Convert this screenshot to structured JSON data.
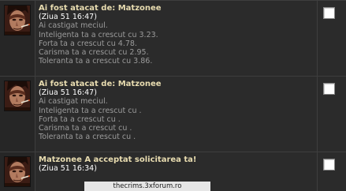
{
  "messages": [
    {
      "title": "Ai fost atacat de: Matzonee",
      "time": "(Ziua 51 16:47)",
      "lines": [
        "Ai castigat meciul.",
        "Inteligenta ta a crescut cu 3.23.",
        "Forta ta a crescut cu 4.78.",
        "Carisma ta a crescut cu 2.95.",
        "Toleranta ta a crescut cu 3.86."
      ],
      "avatar_icon": "character-avatar"
    },
    {
      "title": "Ai fost atacat de: Matzonee",
      "time": "(Ziua 51 16:47)",
      "lines": [
        "Ai castigat meciul.",
        "Inteligenta ta a crescut cu .",
        "Forta ta a crescut cu .",
        "Carisma ta a crescut cu .",
        "Toleranta ta a crescut cu ."
      ],
      "avatar_icon": "character-avatar"
    },
    {
      "title": "Matzonee A acceptat solicitarea ta!",
      "time": "(Ziua 51 16:34)",
      "lines": [],
      "avatar_icon": "character-avatar"
    }
  ],
  "watermark": "thecrims.3xforum.ro",
  "colors": {
    "background": "#2b2b2b",
    "title": "#e8dcb0",
    "time": "#ffffff",
    "body_text": "#9b9b9b",
    "divider": "#3e3e3e"
  }
}
